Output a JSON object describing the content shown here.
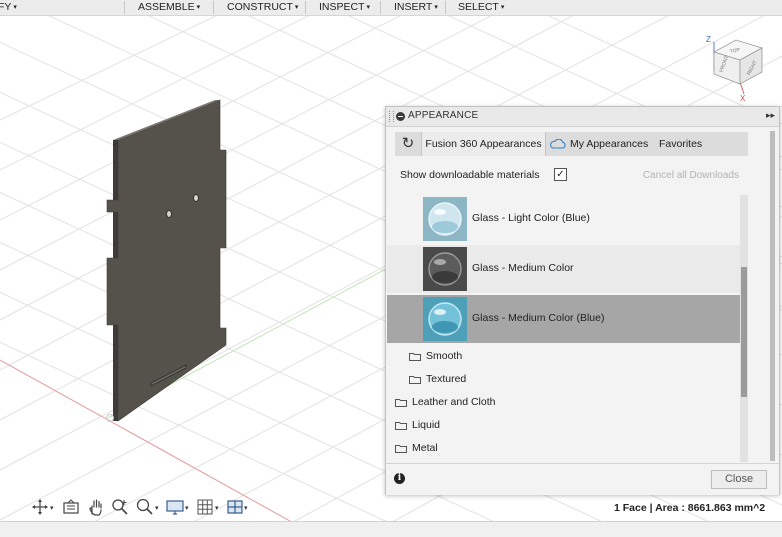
{
  "toolbar": {
    "menus": [
      {
        "label": "FY",
        "caret": "▾"
      },
      {
        "label": "ASSEMBLE",
        "caret": "▾"
      },
      {
        "label": "CONSTRUCT",
        "caret": "▾"
      },
      {
        "label": "INSPECT",
        "caret": "▾"
      },
      {
        "label": "INSERT",
        "caret": "▾"
      },
      {
        "label": "SELECT",
        "caret": "▾"
      }
    ]
  },
  "viewcube": {
    "top_label": "TOP",
    "front_label": "FRONT",
    "right_label": "RIGHT",
    "axis_z": "Z",
    "axis_x": "X"
  },
  "appearance_panel": {
    "title": "APPEARANCE",
    "expand_glyph": "▸▸",
    "refresh_icon": "↻",
    "tabs": {
      "fusion": "Fusion 360 Appearances",
      "my": "My Appearances",
      "favorites": "Favorites"
    },
    "show_downloadable_label": "Show downloadable materials",
    "show_downloadable_checked": true,
    "check_glyph": "✓",
    "cancel_downloads": "Cancel all Downloads",
    "materials": [
      {
        "label": "Glass - Light Color (Blue)",
        "icon": "glass-blue-light-swatch",
        "selected": false
      },
      {
        "label": "Glass - Medium Color",
        "icon": "glass-gray-swatch",
        "selected": false
      },
      {
        "label": "Glass - Medium Color (Blue)",
        "icon": "glass-blue-medium-swatch",
        "selected": true
      }
    ],
    "subfolders": [
      "Smooth",
      "Textured"
    ],
    "folders": [
      "Leather and Cloth",
      "Liquid",
      "Metal"
    ],
    "info_glyph": "i",
    "close_label": "Close"
  },
  "status": {
    "selection_info": "1 Face | Area : 8661.863 mm^2"
  },
  "nav_icons": [
    "orbit-icon",
    "look-at-icon",
    "pan-icon",
    "zoom-icon",
    "zoom-window-icon",
    "display-settings-icon",
    "grid-settings-icon",
    "viewports-icon"
  ],
  "colors": {
    "panel_face": "#55524c",
    "panel_edge": "#3d3b37",
    "grid_line": "#e3e3e3",
    "axis_red": "#e07a7a",
    "axis_green": "#a9dca0",
    "selected_row": "#a6a6a6",
    "accent_blue": "#2f84c9"
  }
}
